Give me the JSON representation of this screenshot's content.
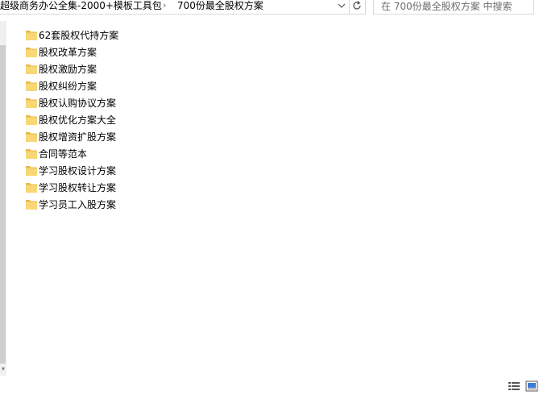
{
  "address_bar": {
    "breadcrumb_parent": "超级商务办公全集-2000+模板工具包",
    "breadcrumb_current": "700份最全股权方案"
  },
  "search": {
    "placeholder": "在 700份最全股权方案 中搜索"
  },
  "files": [
    {
      "name": "62套股权代持方案"
    },
    {
      "name": "股权改革方案"
    },
    {
      "name": "股权激励方案"
    },
    {
      "name": "股权纠纷方案"
    },
    {
      "name": "股权认购协议方案"
    },
    {
      "name": "股权优化方案大全"
    },
    {
      "name": "股权增资扩股方案"
    },
    {
      "name": "合同等范本"
    },
    {
      "name": "学习股权设计方案"
    },
    {
      "name": "学习股权转让方案"
    },
    {
      "name": "学习员工入股方案"
    }
  ],
  "icons": {
    "folder": "folder-icon",
    "dropdown": "chevron-down-icon",
    "refresh": "refresh-icon",
    "details_view": "details-view-icon",
    "large_icons_view": "large-icons-view-icon"
  },
  "colors": {
    "folder_body": "#f8d775",
    "folder_tab": "#e8b84a",
    "border": "#d9d9d9",
    "placeholder_text": "#6d6d6d"
  }
}
